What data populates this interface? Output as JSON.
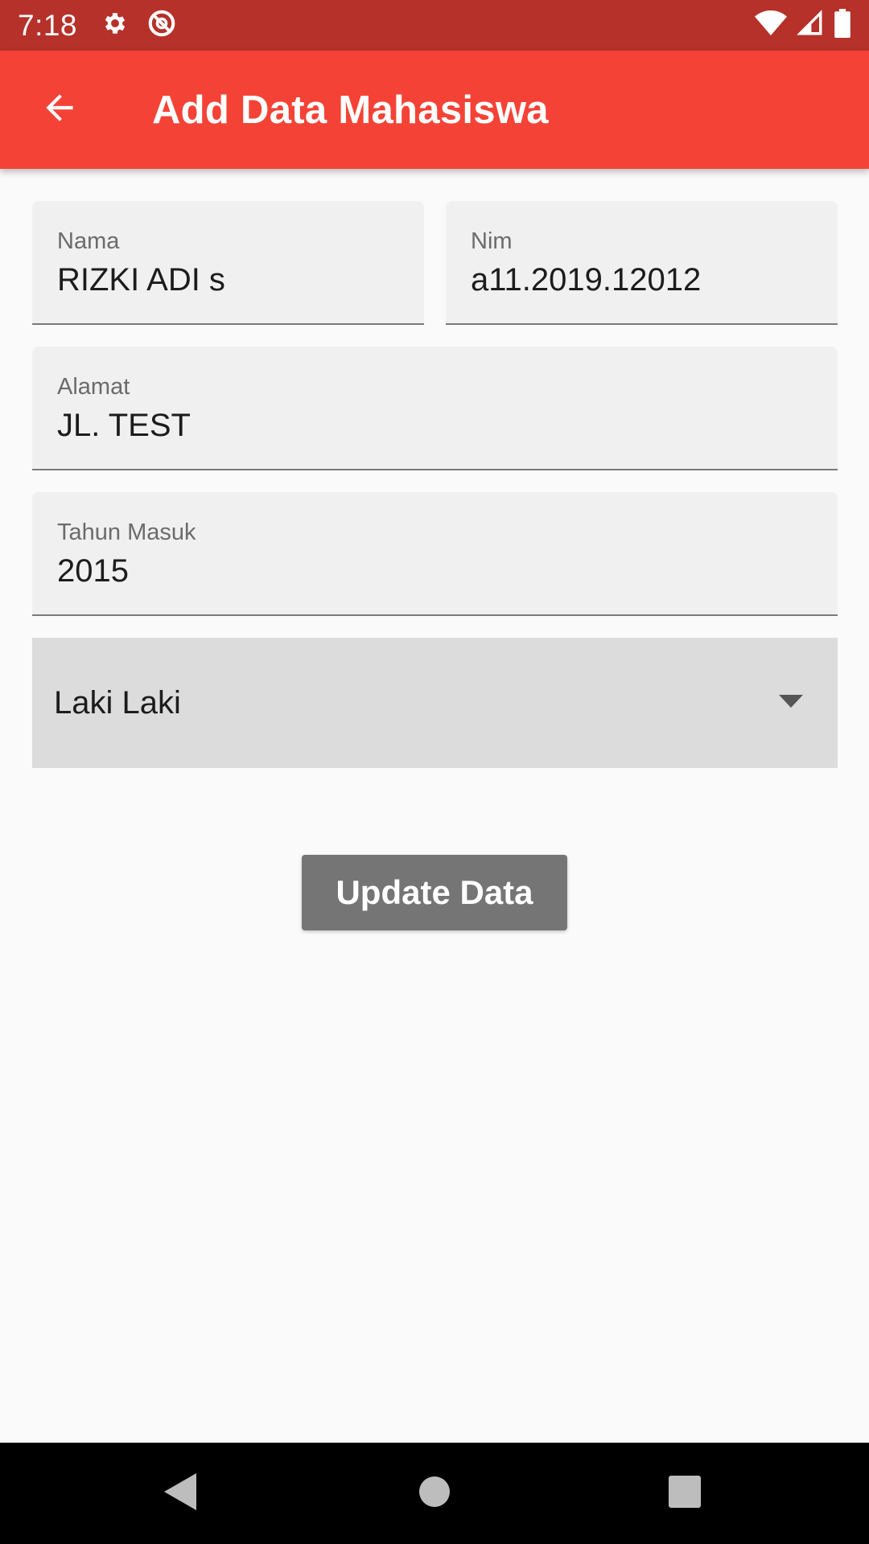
{
  "status_bar": {
    "time": "7:18",
    "icons": [
      "settings-icon",
      "notification-app-icon",
      "wifi-icon",
      "signal-icon",
      "battery-icon"
    ]
  },
  "app_bar": {
    "title": "Add Data Mahasiswa",
    "back_icon": "arrow-back-icon"
  },
  "form": {
    "nama": {
      "label": "Nama",
      "value": "RIZKI ADI s"
    },
    "nim": {
      "label": "Nim",
      "value": "a11.2019.12012"
    },
    "alamat": {
      "label": "Alamat",
      "value": "JL. TEST"
    },
    "tahun_masuk": {
      "label": "Tahun Masuk",
      "value": "2015"
    },
    "jenis_kelamin": {
      "selected": "Laki Laki"
    },
    "submit_label": "Update Data"
  },
  "nav_bar": {
    "icons": [
      "back-triangle-icon",
      "home-circle-icon",
      "recents-square-icon"
    ]
  },
  "colors": {
    "status_bar": "#b5312a",
    "app_bar": "#f44336",
    "field_bg": "#f0f0f0",
    "dropdown_bg": "#dcdcdc",
    "button_bg": "#757575"
  }
}
